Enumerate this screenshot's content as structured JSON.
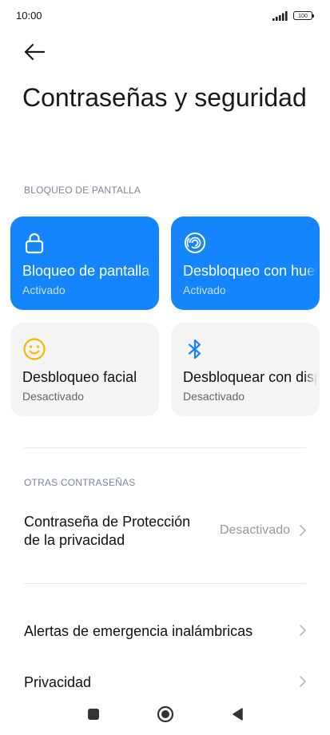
{
  "status_bar": {
    "time": "10:00",
    "battery": "100",
    "icons": [
      "signal-icon",
      "battery-icon"
    ]
  },
  "header": {
    "back_icon": "arrow-left-icon",
    "title": "Contraseñas y seguridad"
  },
  "lock_section": {
    "header": "BLOQUEO DE PANTALLA",
    "tiles": [
      {
        "title": "Bloqueo de pantalla",
        "status": "Activado",
        "icon": "lock-icon",
        "active": true
      },
      {
        "title": "Desbloqueo con huella",
        "status": "Activado",
        "icon": "fingerprint-icon",
        "active": true
      },
      {
        "title": "Desbloqueo facial",
        "status": "Desactivado",
        "icon": "face-icon",
        "active": false
      },
      {
        "title": "Desbloquear con dispositivo Bluetooth",
        "status": "Desactivado",
        "icon": "bluetooth-icon",
        "active": false
      }
    ]
  },
  "other_section": {
    "header": "OTRAS CONTRASEÑAS",
    "privacy_password": {
      "label_line1": "Contraseña de Protección",
      "label_line2": "de la privacidad",
      "value": "Desactivado"
    }
  },
  "rows": {
    "emergency_alerts": "Alertas de emergencia inalámbricas",
    "privacy": "Privacidad"
  },
  "colors": {
    "accent": "#1485fc",
    "tile_inactive": "#f4f4f4",
    "section_header": "#7a8799",
    "face_icon": "#f5b800",
    "bluetooth_icon": "#1485fc"
  },
  "nav_bar": {
    "icons": [
      "recents-square-icon",
      "home-circle-icon",
      "back-triangle-icon"
    ]
  }
}
